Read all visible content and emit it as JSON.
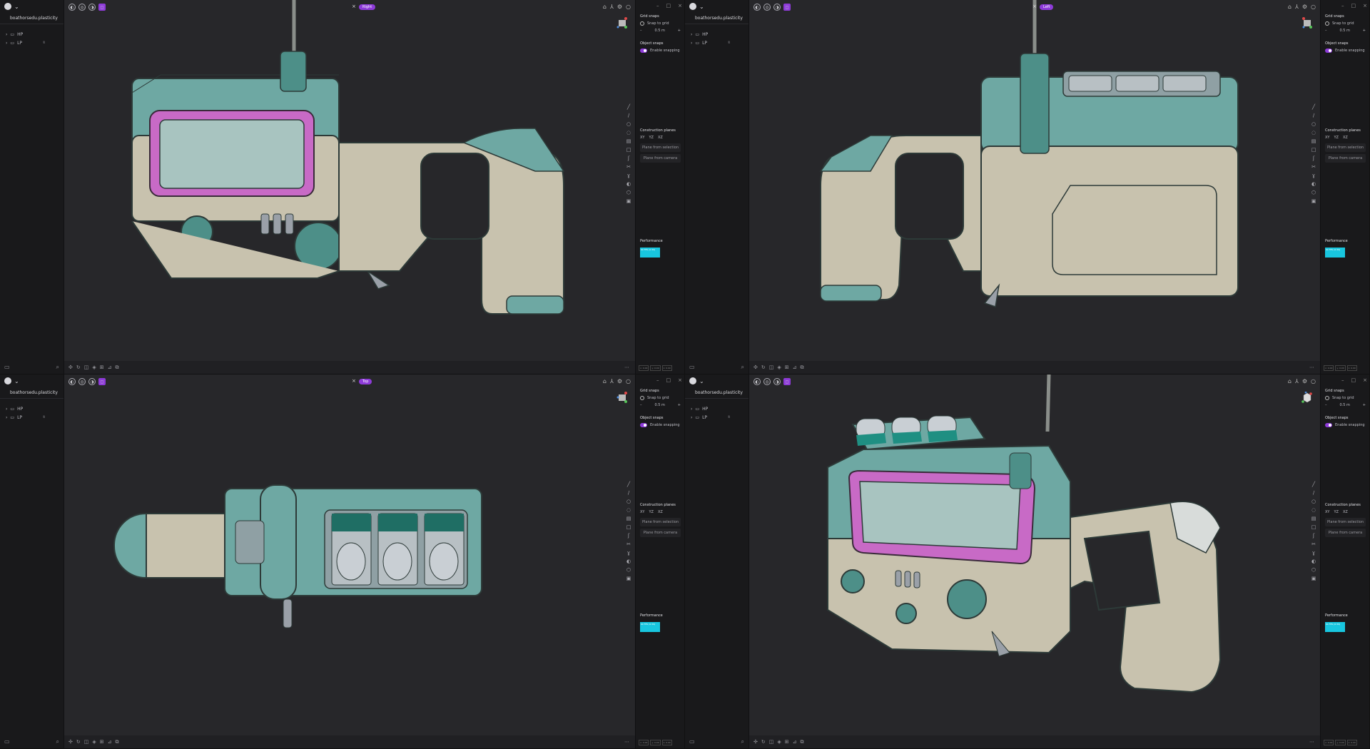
{
  "file_name": "boathorsedu.plasticity",
  "outliner_items": [
    {
      "label": "HP",
      "hidden_label": ""
    },
    {
      "label": "LP",
      "hidden_label": "hid"
    }
  ],
  "panes": [
    {
      "view": "Right"
    },
    {
      "view": "Left"
    },
    {
      "view": "Top"
    },
    {
      "view": ""
    }
  ],
  "panel": {
    "grid_snaps_title": "Grid snaps",
    "snap_to_grid": "Snap to grid",
    "grid_value": "0.5 m",
    "object_snaps_title": "Object snaps",
    "enable_snapping": "Enable snapping",
    "construction_planes_title": "Construction planes",
    "planes": [
      "XY",
      "YZ",
      "XZ"
    ],
    "plane_from_selection": "Plane from selection",
    "plane_from_camera": "Plane from camera",
    "performance_title": "Performance",
    "perf_label": "60 FPS (0-59)",
    "footer": [
      "x: 0.00",
      "y: 0.00",
      "z: 0.00"
    ]
  },
  "colors": {
    "accent": "#8e3bd9",
    "teal": "#6ea8a3",
    "beige": "#c8c2ae",
    "magenta": "#c86ac6",
    "perf": "#18c6df"
  }
}
